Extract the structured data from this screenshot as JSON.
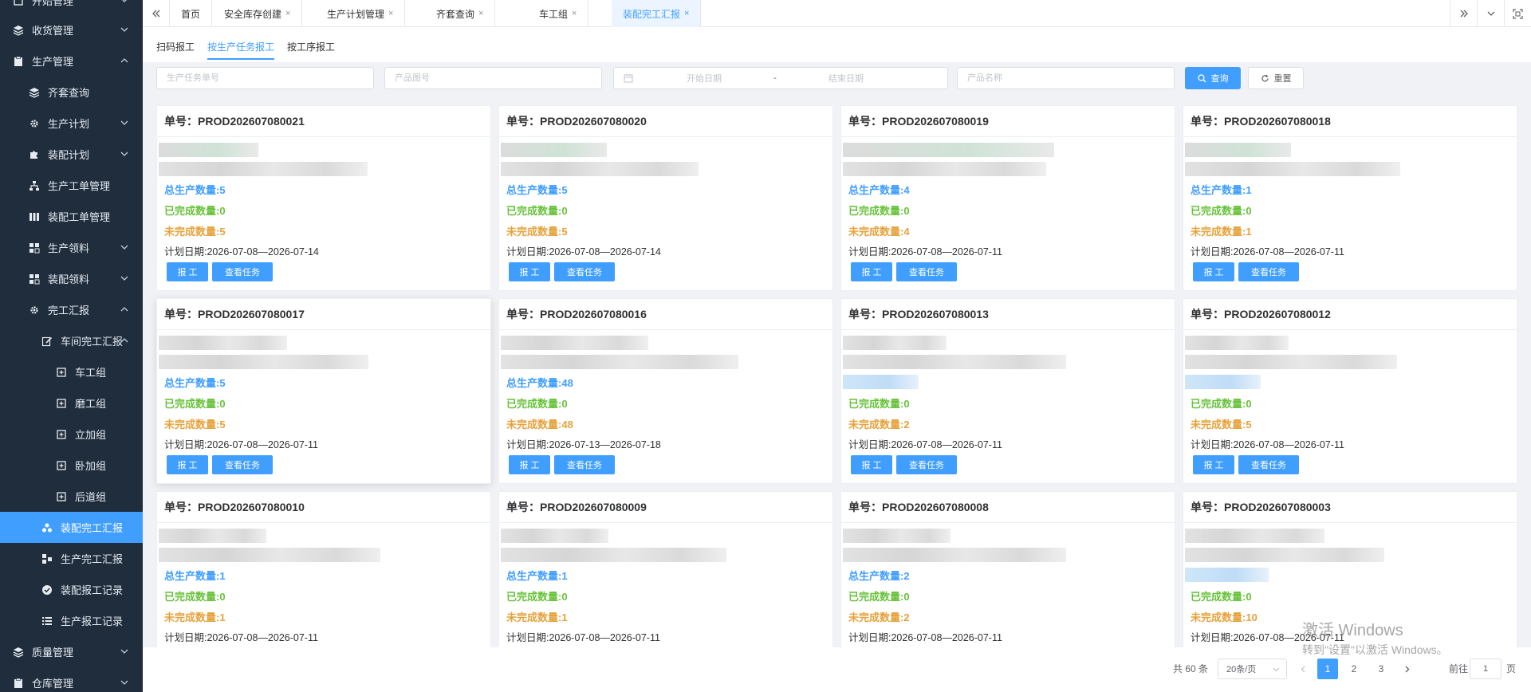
{
  "sidebar": {
    "items": [
      {
        "label": "开始管理",
        "icon": "app-icon",
        "level": 1,
        "chevron": "down"
      },
      {
        "label": "收货管理",
        "icon": "layers-icon",
        "level": 1,
        "chevron": "down"
      },
      {
        "label": "生产管理",
        "icon": "clipboard-icon",
        "level": 1,
        "chevron": "up"
      },
      {
        "label": "齐套查询",
        "icon": "layers-icon",
        "level": 2,
        "chevron": ""
      },
      {
        "label": "生产计划",
        "icon": "gear-icon",
        "level": 2,
        "chevron": "down"
      },
      {
        "label": "装配计划",
        "icon": "puzzle-icon",
        "level": 2,
        "chevron": "down"
      },
      {
        "label": "生产工单管理",
        "icon": "sitemap-icon",
        "level": 2,
        "chevron": ""
      },
      {
        "label": "装配工单管理",
        "icon": "columns-icon",
        "level": 2,
        "chevron": ""
      },
      {
        "label": "生产领料",
        "icon": "grid-icon",
        "level": 2,
        "chevron": "down"
      },
      {
        "label": "装配领料",
        "icon": "grid-icon",
        "level": 2,
        "chevron": "down"
      },
      {
        "label": "完工汇报",
        "icon": "gear-icon",
        "level": 2,
        "chevron": "up"
      },
      {
        "label": "车间完工汇报",
        "icon": "edit-icon",
        "level": 3,
        "chevron": "up"
      },
      {
        "label": "车工组",
        "icon": "plus-square-icon",
        "level": 4,
        "chevron": ""
      },
      {
        "label": "磨工组",
        "icon": "plus-square-icon",
        "level": 4,
        "chevron": ""
      },
      {
        "label": "立加组",
        "icon": "plus-square-icon",
        "level": 4,
        "chevron": ""
      },
      {
        "label": "卧加组",
        "icon": "plus-square-icon",
        "level": 4,
        "chevron": ""
      },
      {
        "label": "后道组",
        "icon": "plus-square-icon",
        "level": 4,
        "chevron": ""
      },
      {
        "label": "装配完工汇报",
        "icon": "cluster-icon",
        "level": 3,
        "chevron": "",
        "active": true
      },
      {
        "label": "生产完工汇报",
        "icon": "blocks-icon",
        "level": 3,
        "chevron": ""
      },
      {
        "label": "装配报工记录",
        "icon": "check-circle-icon",
        "level": 3,
        "chevron": ""
      },
      {
        "label": "生产报工记录",
        "icon": "list-icon",
        "level": 3,
        "chevron": ""
      },
      {
        "label": "质量管理",
        "icon": "layers-icon",
        "level": 1,
        "chevron": "down"
      },
      {
        "label": "仓库管理",
        "icon": "clipboard-icon",
        "level": 1,
        "chevron": "down"
      }
    ]
  },
  "tabs": {
    "items": [
      {
        "label": "首页",
        "closable": false,
        "active": false
      },
      {
        "label": "安全库存创建",
        "closable": true,
        "active": false
      },
      {
        "label": "生产计划管理",
        "closable": true,
        "active": false
      },
      {
        "label": "齐套查询",
        "closable": true,
        "active": false
      },
      {
        "label": "车工组",
        "closable": true,
        "active": false
      },
      {
        "label": "装配完工汇报",
        "closable": true,
        "active": true
      }
    ]
  },
  "subtabs": [
    {
      "label": "扫码报工",
      "active": false
    },
    {
      "label": "按生产任务报工",
      "active": true
    },
    {
      "label": "按工序报工",
      "active": false
    }
  ],
  "filters": {
    "task_no_placeholder": "生产任务单号",
    "part_no_placeholder": "产品图号",
    "start_date_placeholder": "开始日期",
    "date_sep": "-",
    "end_date_placeholder": "结束日期",
    "product_name_placeholder": "产品名称",
    "search_label": "查询",
    "reset_label": "重置"
  },
  "card_labels": {
    "order_prefix": "单号：",
    "total_prefix": "总生产数量:",
    "done_prefix": "已完成数量:",
    "todo_prefix": "未完成数量:",
    "plan_prefix": "计划日期:",
    "report_btn": "报 工",
    "view_btn": "查看任务"
  },
  "cards": [
    {
      "order": "PROD202607080021",
      "total": "5",
      "done": "0",
      "todo": "5",
      "plan": "2026-07-08—2026-07-14",
      "total_hidden": false
    },
    {
      "order": "PROD202607080020",
      "total": "5",
      "done": "0",
      "todo": "5",
      "plan": "2026-07-08—2026-07-14",
      "total_hidden": false
    },
    {
      "order": "PROD202607080019",
      "total": "4",
      "done": "0",
      "todo": "4",
      "plan": "2026-07-08—2026-07-11",
      "total_hidden": false
    },
    {
      "order": "PROD202607080018",
      "total": "1",
      "done": "0",
      "todo": "1",
      "plan": "2026-07-08—2026-07-11",
      "total_hidden": false
    },
    {
      "order": "PROD202607080017",
      "total": "5",
      "done": "0",
      "todo": "5",
      "plan": "2026-07-08—2026-07-11",
      "total_hidden": false
    },
    {
      "order": "PROD202607080016",
      "total": "48",
      "done": "0",
      "todo": "48",
      "plan": "2026-07-13—2026-07-18",
      "total_hidden": false
    },
    {
      "order": "PROD202607080013",
      "total": "",
      "done": "0",
      "todo": "2",
      "plan": "2026-07-08—2026-07-11",
      "total_hidden": true
    },
    {
      "order": "PROD202607080012",
      "total": "",
      "done": "0",
      "todo": "5",
      "plan": "2026-07-08—2026-07-11",
      "total_hidden": true
    },
    {
      "order": "PROD202607080010",
      "total": "1",
      "done": "0",
      "todo": "1",
      "plan": "2026-07-08—2026-07-11",
      "total_hidden": false
    },
    {
      "order": "PROD202607080009",
      "total": "1",
      "done": "0",
      "todo": "1",
      "plan": "2026-07-08—2026-07-11",
      "total_hidden": false
    },
    {
      "order": "PROD202607080008",
      "total": "2",
      "done": "0",
      "todo": "2",
      "plan": "2026-07-08—2026-07-11",
      "total_hidden": false
    },
    {
      "order": "PROD202607080003",
      "total": "",
      "done": "0",
      "todo": "10",
      "plan": "2026-07-08—2026-07-11",
      "total_hidden": true
    }
  ],
  "pagination": {
    "total_text": "共 60 条",
    "page_size": "20条/页",
    "pages": [
      "1",
      "2",
      "3"
    ],
    "current": "1",
    "goto_label": "前往",
    "goto_value": "1",
    "page_suffix": "页"
  },
  "watermark": {
    "line1": "激活 Windows",
    "line2": "转到\"设置\"以激活 Windows。"
  },
  "colors": {
    "primary": "#409eff",
    "success": "#67c23a",
    "warning": "#e6a23c",
    "sidebar_bg": "#1f2d3d"
  }
}
